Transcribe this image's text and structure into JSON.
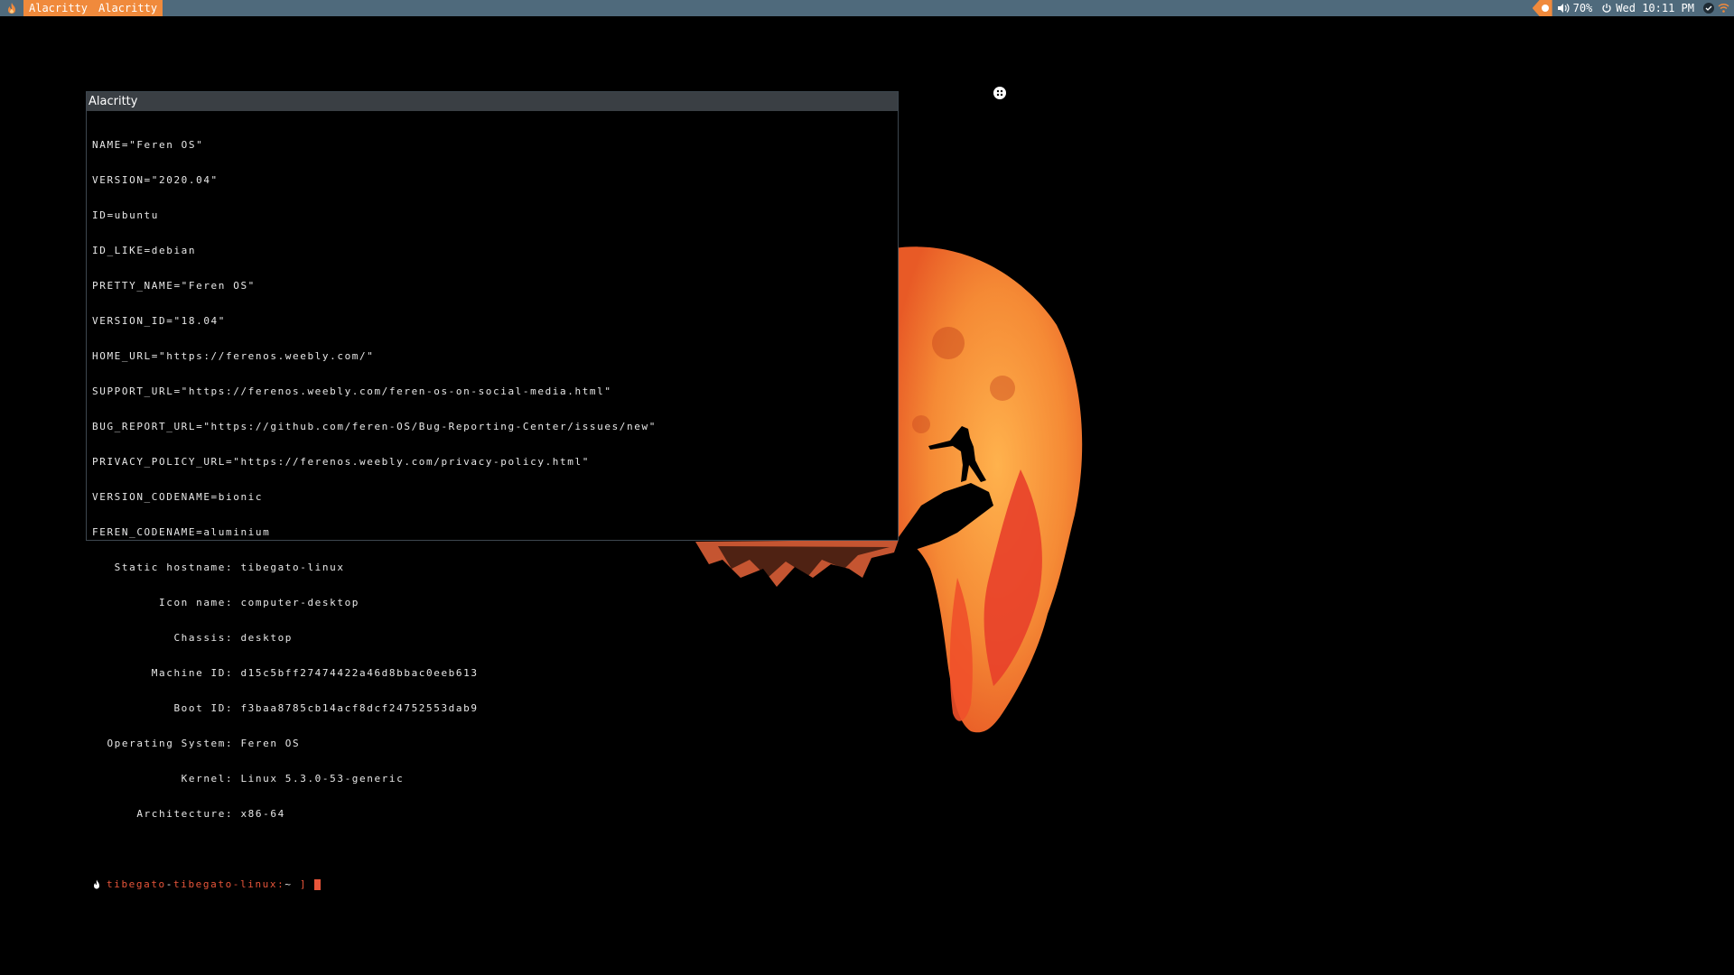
{
  "topbar": {
    "logo_icon": "flame-icon",
    "tabs": [
      "Alacritty",
      "Alacritty"
    ],
    "volume": "70%",
    "datetime": "Wed 10:11 PM",
    "colors": {
      "bar": "#4f6a7c",
      "accent": "#f08a3c"
    }
  },
  "terminal": {
    "title": "Alacritty",
    "os_release": [
      "NAME=\"Feren OS\"",
      "VERSION=\"2020.04\"",
      "ID=ubuntu",
      "ID_LIKE=debian",
      "PRETTY_NAME=\"Feren OS\"",
      "VERSION_ID=\"18.04\"",
      "HOME_URL=\"https://ferenos.weebly.com/\"",
      "SUPPORT_URL=\"https://ferenos.weebly.com/feren-os-on-social-media.html\"",
      "BUG_REPORT_URL=\"https://github.com/feren-OS/Bug-Reporting-Center/issues/new\"",
      "PRIVACY_POLICY_URL=\"https://ferenos.weebly.com/privacy-policy.html\"",
      "VERSION_CODENAME=bionic",
      "FEREN_CODENAME=aluminium"
    ],
    "hostnamectl": [
      "   Static hostname: tibegato-linux",
      "         Icon name: computer-desktop",
      "           Chassis: desktop",
      "        Machine ID: d15c5bff27474422a46d8bbac0eeb613",
      "           Boot ID: f3baa8785cb14acf8dcf24752553dab9",
      "  Operating System: Feren OS",
      "            Kernel: Linux 5.3.0-53-generic",
      "      Architecture: x86-64"
    ],
    "prompt": {
      "user": "tibegato",
      "sep": "-",
      "host": "tibegato-linux:",
      "path": "~",
      "bracket": "]"
    },
    "colors": {
      "prompt": "#e8553a",
      "text": "#e8e8e8",
      "background": "#000000"
    }
  }
}
